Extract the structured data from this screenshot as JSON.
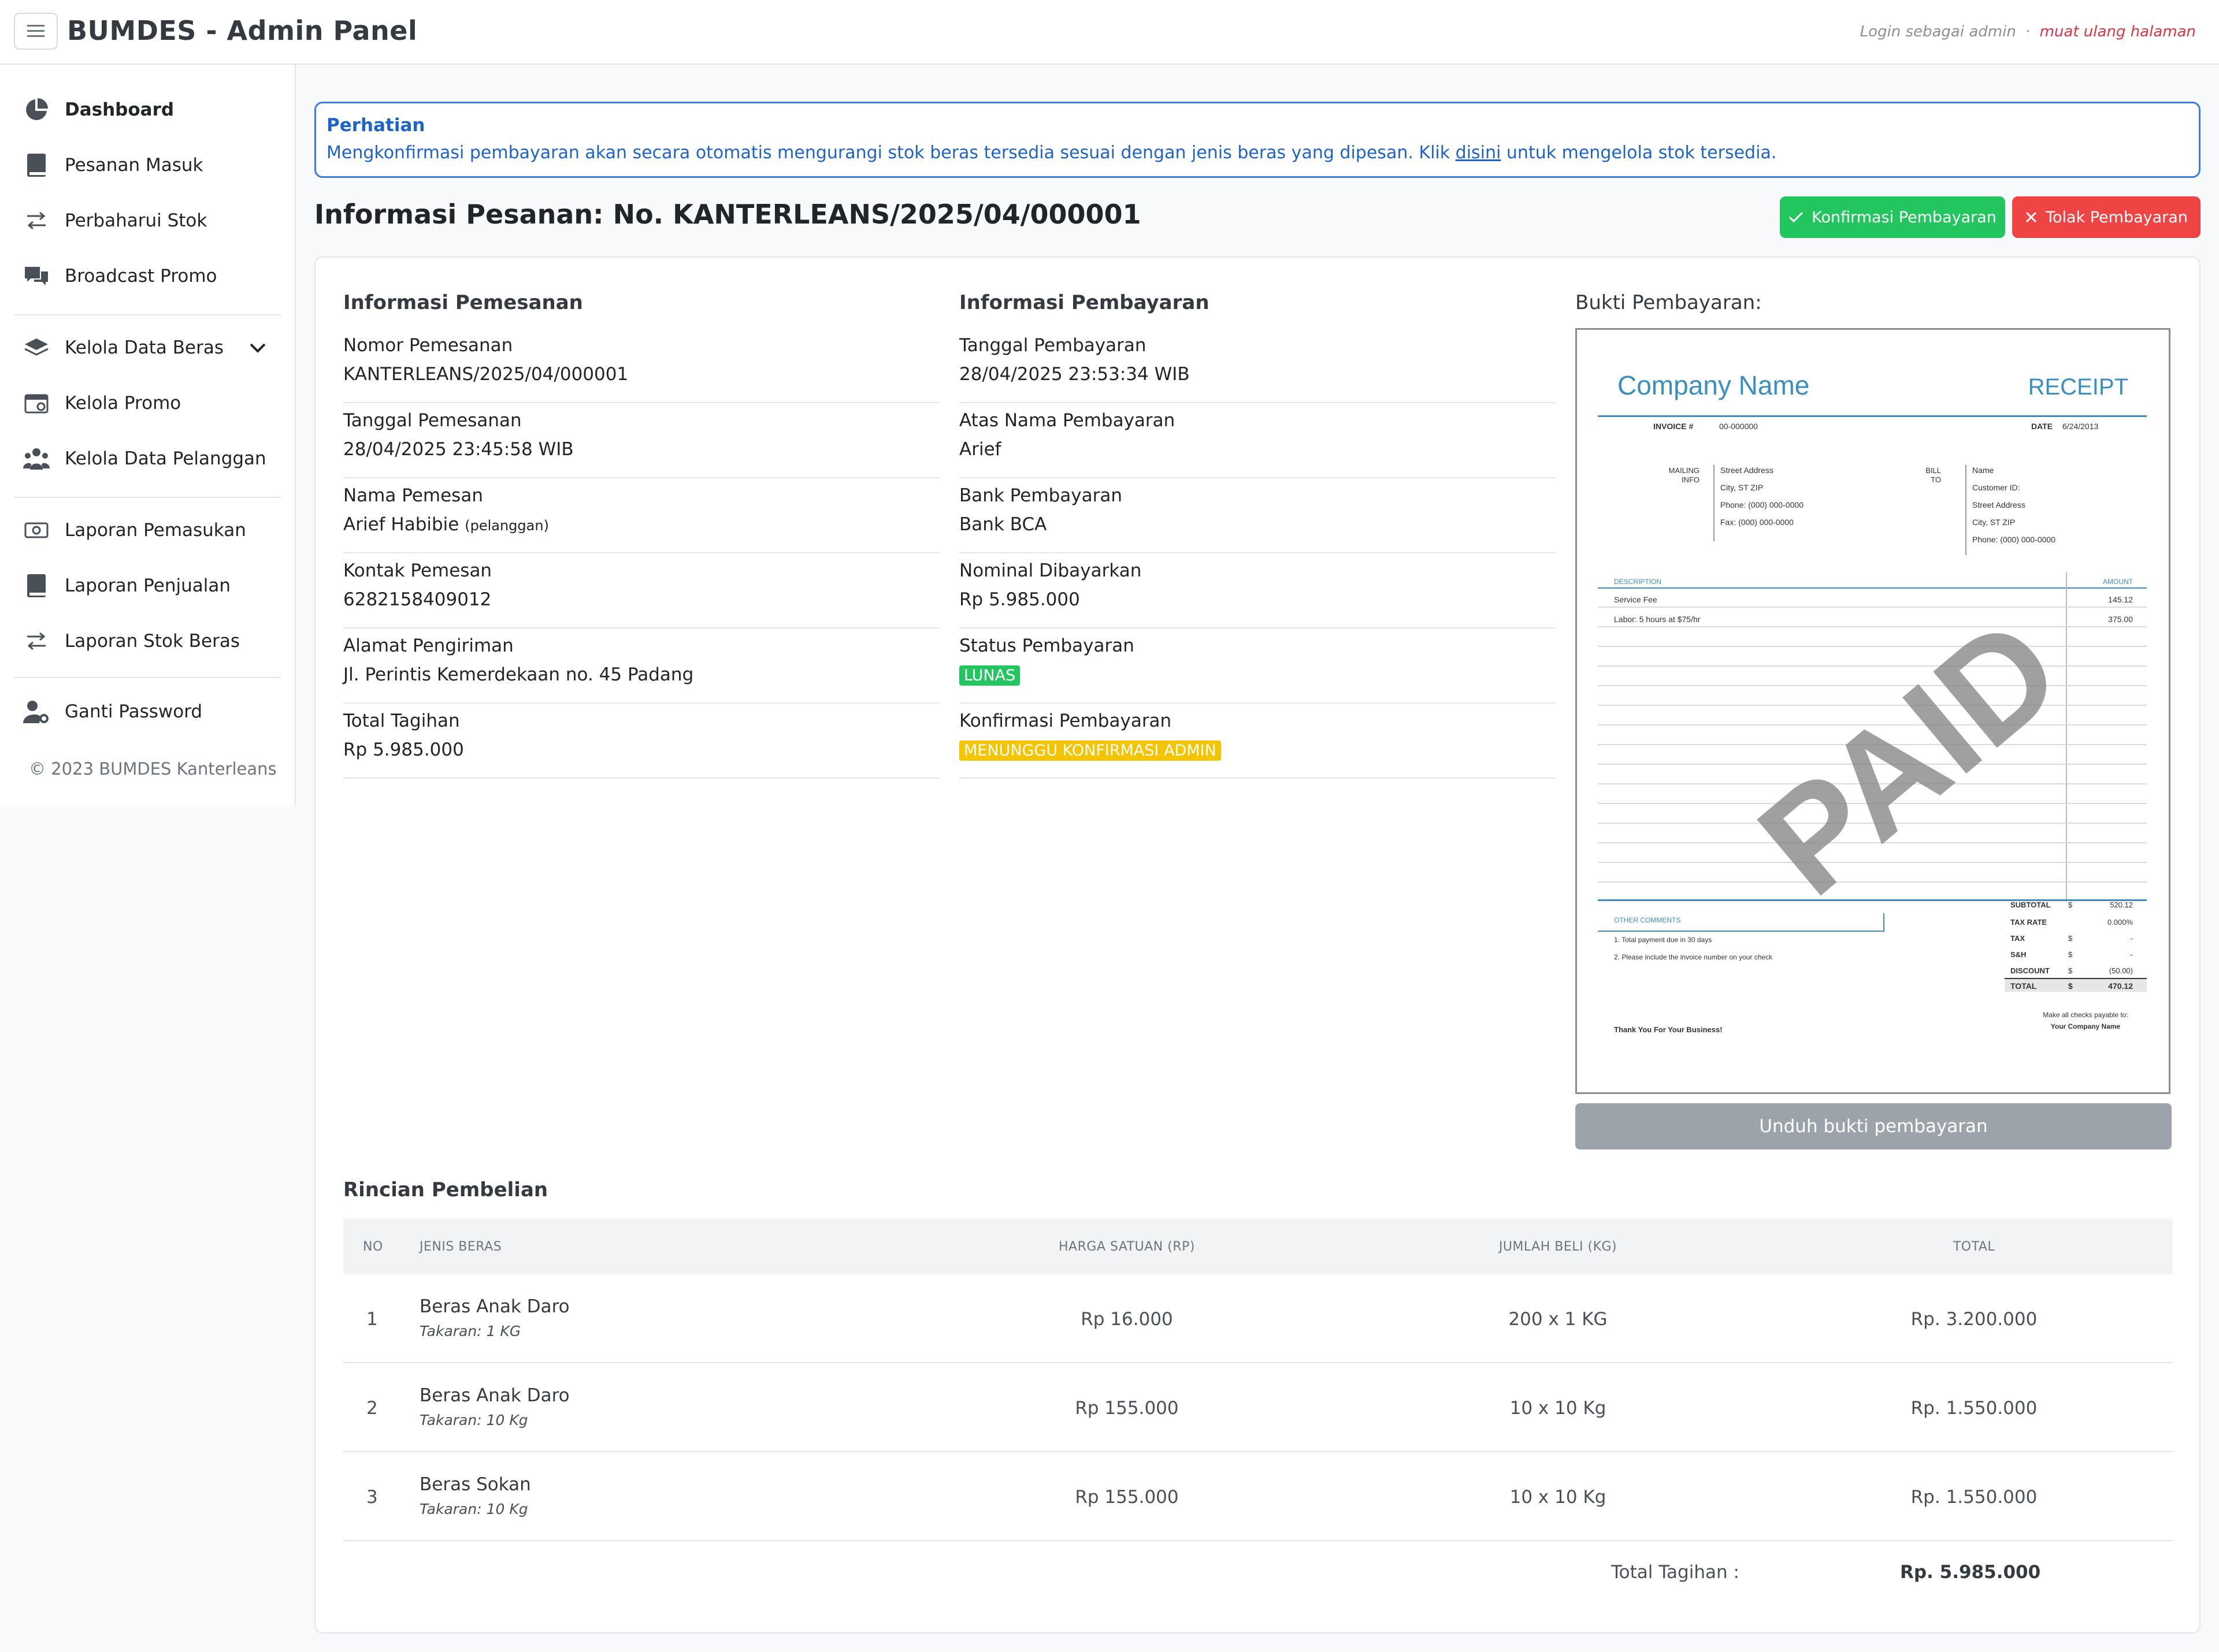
{
  "header": {
    "title": "BUMDES - Admin Panel",
    "login_text": "Login sebagai admin",
    "separator": "·",
    "reload_link": "muat ulang halaman"
  },
  "sidebar": {
    "items": [
      {
        "label": "Dashboard",
        "icon": "pie-chart-icon"
      },
      {
        "label": "Pesanan Masuk",
        "icon": "book-icon"
      },
      {
        "label": "Perbaharui Stok",
        "icon": "arrows-exchange-icon"
      },
      {
        "label": "Broadcast Promo",
        "icon": "chat-bubbles-icon"
      },
      {
        "label": "Kelola Data Beras",
        "icon": "layers-icon"
      },
      {
        "label": "Kelola Promo",
        "icon": "calendar-icon"
      },
      {
        "label": "Kelola Data Pelanggan",
        "icon": "users-icon"
      },
      {
        "label": "Laporan Pemasukan",
        "icon": "money-icon"
      },
      {
        "label": "Laporan Penjualan",
        "icon": "book-icon"
      },
      {
        "label": "Laporan Stok Beras",
        "icon": "arrows-exchange-icon"
      },
      {
        "label": "Ganti Password",
        "icon": "user-gear-icon"
      }
    ],
    "copyright": "© 2023 BUMDES Kanterleans"
  },
  "alert": {
    "title": "Perhatian",
    "text_before": "Mengkonfirmasi pembayaran akan secara otomatis mengurangi stok beras tersedia sesuai dengan jenis beras yang dipesan. Klik ",
    "link": "disini",
    "text_after": " untuk mengelola stok tersedia."
  },
  "page": {
    "title": "Informasi Pesanan: No. KANTERLEANS/2025/04/000001",
    "confirm_button": "Konfirmasi Pembayaran",
    "reject_button": "Tolak Pembayaran"
  },
  "order_info": {
    "title": "Informasi Pemesanan",
    "fields": [
      {
        "label": "Nomor Pemesanan",
        "value": "KANTERLEANS/2025/04/000001"
      },
      {
        "label": "Tanggal Pemesanan",
        "value": "28/04/2025 23:45:58 WIB"
      },
      {
        "label": "Nama Pemesan",
        "value": "Arief Habibie",
        "note": "(pelanggan)"
      },
      {
        "label": "Kontak Pemesan",
        "value": "6282158409012"
      },
      {
        "label": "Alamat Pengiriman",
        "value": "Jl. Perintis Kemerdekaan no. 45 Padang"
      },
      {
        "label": "Total Tagihan",
        "value": "Rp 5.985.000"
      }
    ]
  },
  "payment_info": {
    "title": "Informasi Pembayaran",
    "fields": [
      {
        "label": "Tanggal Pembayaran",
        "value": "28/04/2025 23:53:34 WIB"
      },
      {
        "label": "Atas Nama Pembayaran",
        "value": "Arief"
      },
      {
        "label": "Bank Pembayaran",
        "value": "Bank BCA"
      },
      {
        "label": "Nominal Dibayarkan",
        "value": "Rp 5.985.000"
      },
      {
        "label": "Status Pembayaran",
        "value": "LUNAS"
      },
      {
        "label": "Konfirmasi Pembayaran",
        "value": "MENUNGGU KONFIRMASI ADMIN"
      }
    ]
  },
  "proof": {
    "label": "Bukti Pembayaran:",
    "download_button": "Unduh bukti pembayaran",
    "receipt": {
      "company": "Company Name",
      "heading": "RECEIPT",
      "invoice_label": "INVOICE #",
      "invoice_no": "00-000000",
      "date_label": "DATE",
      "date": "6/24/2013",
      "mailing_label": "MAILING",
      "mailing_label2": "INFO",
      "mailing_lines": [
        "Street Address",
        "City, ST  ZIP",
        "Phone: (000) 000-0000",
        "Fax: (000) 000-0000"
      ],
      "bill_label": "BILL",
      "bill_label2": "TO",
      "bill_lines": [
        "Name",
        "Customer ID:",
        "Street Address",
        "City, ST  ZIP",
        "Phone: (000) 000-0000"
      ],
      "desc_header": "DESCRIPTION",
      "amount_header": "AMOUNT",
      "lines": [
        {
          "desc": "Service Fee",
          "amount": "145.12"
        },
        {
          "desc": "Labor: 5 hours at $75/hr",
          "amount": "375.00"
        }
      ],
      "stamp": "PAID",
      "comments_label": "OTHER COMMENTS",
      "comments": [
        "1. Total payment due in 30 days",
        "2. Please include the invoice number on your check"
      ],
      "totals": [
        {
          "label": "SUBTOTAL",
          "cur": "$",
          "value": "520.12"
        },
        {
          "label": "TAX RATE",
          "cur": "",
          "value": "0.000%"
        },
        {
          "label": "TAX",
          "cur": "$",
          "value": "-"
        },
        {
          "label": "S&H",
          "cur": "$",
          "value": "-"
        },
        {
          "label": "DISCOUNT",
          "cur": "$",
          "value": "(50.00)"
        },
        {
          "label": "TOTAL",
          "cur": "$",
          "value": "470.12"
        }
      ],
      "thanks": "Thank You For Your Business!",
      "payable1": "Make all checks payable to:",
      "payable2": "Your Company Name"
    }
  },
  "purchase": {
    "title": "Rincian Pembelian",
    "headers": {
      "no": "NO",
      "type": "JENIS BERAS",
      "price": "HARGA SATUAN (RP)",
      "qty": "JUMLAH BELI (KG)",
      "total": "TOTAL"
    },
    "rows": [
      {
        "no": "1",
        "name": "Beras Anak Daro",
        "size": "Takaran: 1 KG",
        "price": "Rp 16.000",
        "qty": "200 x 1 KG",
        "total": "Rp. 3.200.000"
      },
      {
        "no": "2",
        "name": "Beras Anak Daro",
        "size": "Takaran: 10 Kg",
        "price": "Rp 155.000",
        "qty": "10 x 10 Kg",
        "total": "Rp. 1.550.000"
      },
      {
        "no": "3",
        "name": "Beras Sokan",
        "size": "Takaran: 10 Kg",
        "price": "Rp 155.000",
        "qty": "10 x 10 Kg",
        "total": "Rp. 1.550.000"
      }
    ],
    "total_label": "Total Tagihan :",
    "total_value": "Rp. 5.985.000"
  }
}
